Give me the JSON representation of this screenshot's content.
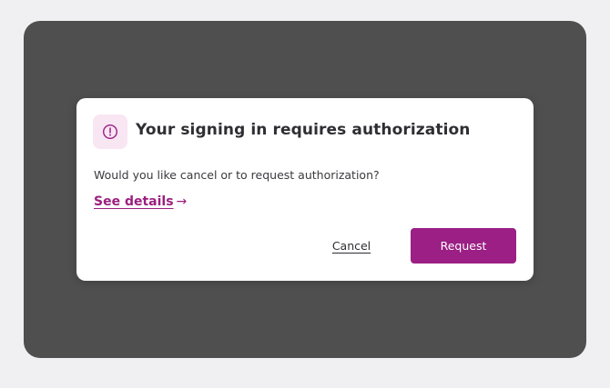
{
  "dialog": {
    "title": "Your signing in requires authorization",
    "message": "Would you like cancel or to request authorization?",
    "details_link_label": "See details",
    "details_link_arrow": "→",
    "cancel_label": "Cancel",
    "request_label": "Request",
    "icon": "alert-circle-icon"
  },
  "colors": {
    "accent": "#9b1f84",
    "icon_badge_bg": "#f8e6f3",
    "backdrop": "#4f4f4f",
    "page_bg": "#f0f0f2",
    "dialog_bg": "#ffffff"
  }
}
